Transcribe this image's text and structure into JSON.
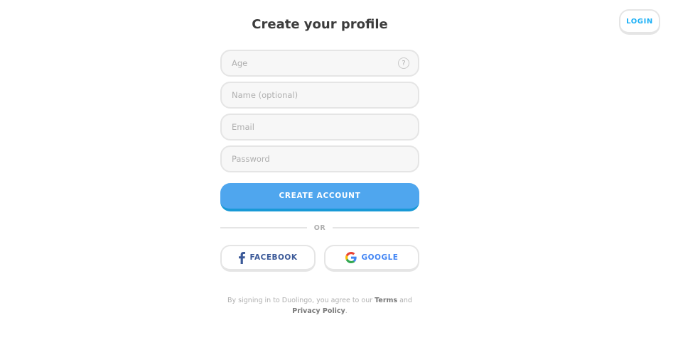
{
  "header": {
    "login_label": "LOGIN"
  },
  "form": {
    "title": "Create your profile",
    "fields": {
      "age": {
        "placeholder": "Age",
        "help_icon": "question-mark-icon",
        "help_glyph": "?"
      },
      "name": {
        "placeholder": "Name (optional)"
      },
      "email": {
        "placeholder": "Email"
      },
      "password": {
        "placeholder": "Password"
      }
    },
    "create_label": "CREATE ACCOUNT",
    "divider_label": "OR"
  },
  "social": {
    "facebook": {
      "label": "FACEBOOK",
      "icon": "facebook-icon",
      "color": "#3b5998"
    },
    "google": {
      "label": "GOOGLE",
      "icon": "google-icon",
      "color": "#4285f4"
    }
  },
  "legal": {
    "prefix": "By signing in to Duolingo, you agree to our",
    "terms": "Terms",
    "and": "and",
    "privacy": "Privacy Policy",
    "period": "."
  },
  "colors": {
    "accent": "#1cb0f6",
    "primary_button": "#4fa6ee",
    "field_bg": "#f7f7f7",
    "border": "#e5e5e5"
  }
}
